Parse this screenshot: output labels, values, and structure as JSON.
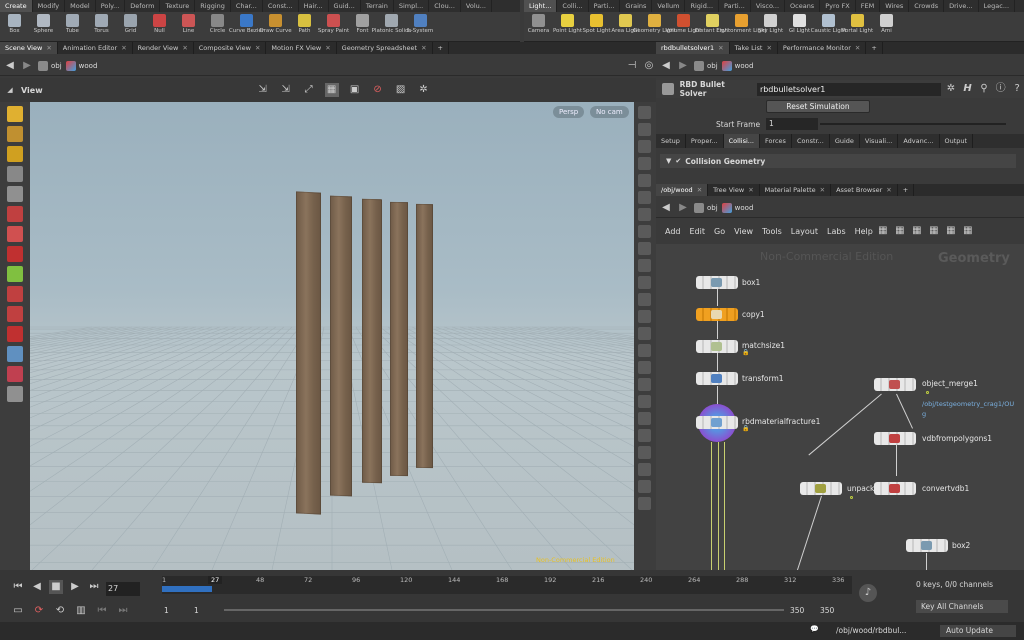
{
  "shelf": {
    "left_tabs": [
      "Create",
      "Modify",
      "Model",
      "Poly...",
      "Deform",
      "Texture",
      "Rigging",
      "Char...",
      "Const...",
      "Hair...",
      "Guid...",
      "Terrain",
      "Simpl...",
      "Clou...",
      "Volu..."
    ],
    "left_tools": [
      {
        "label": "Box",
        "icon": "box-icon",
        "color": "#a8b4c0"
      },
      {
        "label": "Sphere",
        "icon": "sphere-icon",
        "color": "#b0b8c2"
      },
      {
        "label": "Tube",
        "icon": "tube-icon",
        "color": "#a0aab5"
      },
      {
        "label": "Torus",
        "icon": "torus-icon",
        "color": "#9fa9b4"
      },
      {
        "label": "Grid",
        "icon": "grid-icon",
        "color": "#9aa4ae"
      },
      {
        "label": "Null",
        "icon": "null-icon",
        "color": "#cc4444"
      },
      {
        "label": "Line",
        "icon": "line-icon",
        "color": "#cc5555"
      },
      {
        "label": "Circle",
        "icon": "circle-icon",
        "color": "#888888"
      },
      {
        "label": "Curve Bezier",
        "icon": "curve-bezier-icon",
        "color": "#3a78c8"
      },
      {
        "label": "Draw Curve",
        "icon": "draw-curve-icon",
        "color": "#c89030"
      },
      {
        "label": "Path",
        "icon": "path-icon",
        "color": "#d8c040"
      },
      {
        "label": "Spray Paint",
        "icon": "spray-paint-icon",
        "color": "#cc5050"
      },
      {
        "label": "Font",
        "icon": "font-icon",
        "color": "#a0a0a0"
      },
      {
        "label": "Platonic Solids",
        "icon": "platonic-solids-icon",
        "color": "#a0a8b0"
      },
      {
        "label": "L-System",
        "icon": "l-system-icon",
        "color": "#5080c0"
      }
    ],
    "right_tabs": [
      "Light...",
      "Colli...",
      "Parti...",
      "Grains",
      "Vellum",
      "Rigid...",
      "Parti...",
      "Visco...",
      "Oceans",
      "Pyro FX",
      "FEM",
      "Wires",
      "Crowds",
      "Drive...",
      "Legac..."
    ],
    "right_tools": [
      {
        "label": "Camera",
        "icon": "camera-icon",
        "color": "#909090"
      },
      {
        "label": "Point Light",
        "icon": "point-light-icon",
        "color": "#e8d040"
      },
      {
        "label": "Spot Light",
        "icon": "spot-light-icon",
        "color": "#e8c030"
      },
      {
        "label": "Area Light",
        "icon": "area-light-icon",
        "color": "#e0c850"
      },
      {
        "label": "Geometry Light",
        "icon": "geometry-light-icon",
        "color": "#e0b040"
      },
      {
        "label": "Volume Light",
        "icon": "volume-light-icon",
        "color": "#d05030"
      },
      {
        "label": "Distant Light",
        "icon": "distant-light-icon",
        "color": "#e0d060"
      },
      {
        "label": "Environment Light",
        "icon": "environment-light-icon",
        "color": "#e8a030"
      },
      {
        "label": "Sky Light",
        "icon": "sky-light-icon",
        "color": "#d0d0d0"
      },
      {
        "label": "GI Light",
        "icon": "gi-light-icon",
        "color": "#e0e0e0"
      },
      {
        "label": "Caustic Light",
        "icon": "caustic-light-icon",
        "color": "#b0c0d0"
      },
      {
        "label": "Portal Light",
        "icon": "portal-light-icon",
        "color": "#e0c040"
      },
      {
        "label": "Ami",
        "icon": "ambient-light-icon",
        "color": "#d0d0d0"
      }
    ]
  },
  "left_pane": {
    "tabs": [
      "Scene View",
      "Animation Editor",
      "Render View",
      "Composite View",
      "Motion FX View",
      "Geometry Spreadsheet"
    ],
    "path": {
      "root": "obj",
      "node": "wood"
    },
    "view_label": "View",
    "persp": "Persp",
    "cam": "No cam",
    "watermark": "Non-Commercial Edition"
  },
  "params": {
    "tabs": [
      "rbdbulletsolver1",
      "Take List",
      "Performance Monitor"
    ],
    "path": {
      "root": "obj",
      "node": "wood"
    },
    "node_type": "RBD Bullet Solver",
    "node_name": "rbdbulletsolver1",
    "reset_button": "Reset Simulation",
    "start_frame_label": "Start Frame",
    "start_frame_value": "1",
    "sub_tabs": [
      "Setup",
      "Proper...",
      "Collisi...",
      "Forces",
      "Constr...",
      "Guide",
      "Visuali...",
      "Advanc...",
      "Output"
    ],
    "section": "Collision Geometry"
  },
  "network": {
    "tabs": [
      "/obj/wood",
      "Tree View",
      "Material Palette",
      "Asset Browser"
    ],
    "path": {
      "root": "obj",
      "node": "wood"
    },
    "menu": [
      "Add",
      "Edit",
      "Go",
      "View",
      "Tools",
      "Layout",
      "Labs",
      "Help"
    ],
    "watermark": "Non-Commercial Edition",
    "context": "Geometry",
    "nodes": [
      {
        "name": "box1"
      },
      {
        "name": "copy1"
      },
      {
        "name": "matchsize1"
      },
      {
        "name": "transform1"
      },
      {
        "name": "rbdmaterialfracture1"
      },
      {
        "name": "object_merge1",
        "sub": "/obj/testgeometry_crag1/OU",
        "sub2": "g"
      },
      {
        "name": "vdbfrompolygons1"
      },
      {
        "name": "unpack"
      },
      {
        "name": "convertvdb1"
      },
      {
        "name": "box2"
      }
    ]
  },
  "timeline": {
    "current_frame": "27",
    "ticks": [
      "1",
      "27",
      "48",
      "72",
      "96",
      "120",
      "144",
      "168",
      "192",
      "216",
      "240",
      "264",
      "288",
      "312",
      "336"
    ],
    "range_start": "1",
    "range_start2": "1",
    "range_end": "350",
    "range_end2": "350",
    "keys": "0 keys, 0/0 channels",
    "key_all": "Key All Channels",
    "current_fraction": 0.073
  },
  "status": {
    "path": "/obj/wood/rbdbul...",
    "update": "Auto Update"
  }
}
